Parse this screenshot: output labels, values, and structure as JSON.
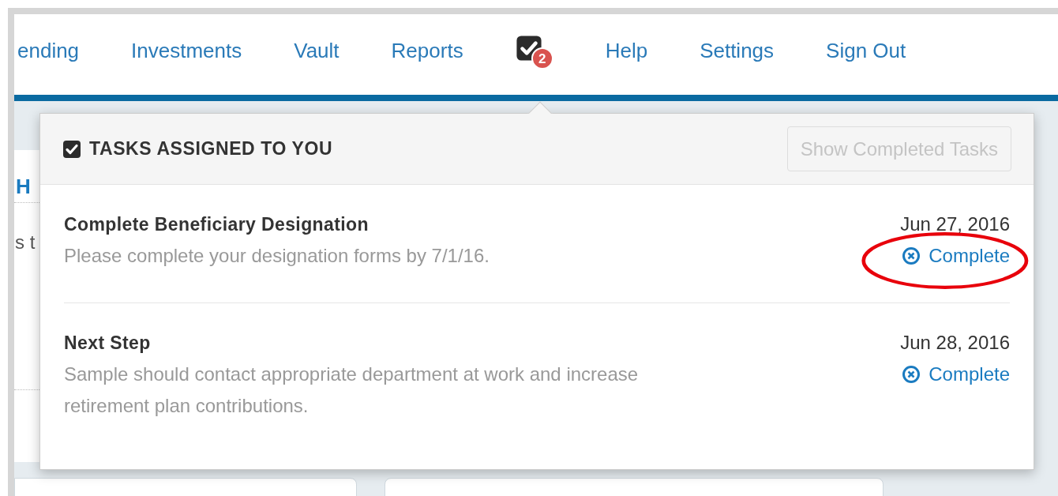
{
  "nav": {
    "items": [
      {
        "kind": "link",
        "label": "ending"
      },
      {
        "kind": "link",
        "label": "Investments"
      },
      {
        "kind": "link",
        "label": "Vault"
      },
      {
        "kind": "link",
        "label": "Reports"
      },
      {
        "kind": "tasks",
        "badge": "2"
      },
      {
        "kind": "link",
        "label": "Help"
      },
      {
        "kind": "link",
        "label": "Settings"
      },
      {
        "kind": "link",
        "label": "Sign Out"
      }
    ]
  },
  "background": {
    "heading": "H",
    "text": "s t"
  },
  "tasks_popup": {
    "title": "TASKS ASSIGNED TO YOU",
    "button": {
      "label": "Show Completed Tasks",
      "disabled": true
    },
    "tasks": [
      {
        "title": "Complete Beneficiary Designation",
        "description": "Please complete your designation forms by 7/1/16.",
        "date": "Jun 27, 2016",
        "action": "Complete",
        "highlighted": true
      },
      {
        "title": "Next Step",
        "description": "Sample should contact appropriate department at work and increase retirement plan contributions.",
        "date": "Jun 28, 2016",
        "action": "Complete",
        "highlighted": false
      }
    ]
  }
}
